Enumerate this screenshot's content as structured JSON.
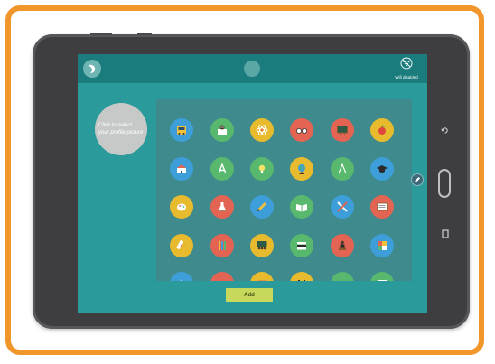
{
  "topbar": {
    "wifi_label": "Wifi disabled"
  },
  "profile": {
    "prompt": "Click to select your profile picture"
  },
  "actions": {
    "add_label": "Add"
  },
  "icon_grid": {
    "rows": [
      [
        {
          "name": "school-bus-icon",
          "color": "#3d9ed9"
        },
        {
          "name": "book-owl-icon",
          "color": "#58b86d"
        },
        {
          "name": "atom-icon",
          "color": "#e8bb2f"
        },
        {
          "name": "glasses-icon",
          "color": "#e46454"
        },
        {
          "name": "blackboard-icon",
          "color": "#e46454"
        },
        {
          "name": "apple-icon",
          "color": "#e8bb2f"
        }
      ],
      [
        {
          "name": "school-building-icon",
          "color": "#3d9ed9"
        },
        {
          "name": "letter-a-icon",
          "color": "#58b86d"
        },
        {
          "name": "lightbulb-icon",
          "color": "#58b86d"
        },
        {
          "name": "globe-icon",
          "color": "#e8bb2f"
        },
        {
          "name": "compass-icon",
          "color": "#58b86d"
        },
        {
          "name": "graduation-cap-icon",
          "color": "#3d9ed9"
        }
      ],
      [
        {
          "name": "palette-icon",
          "color": "#e8bb2f"
        },
        {
          "name": "flask-icon",
          "color": "#e46454"
        },
        {
          "name": "pencil-icon",
          "color": "#3d9ed9"
        },
        {
          "name": "open-book-icon",
          "color": "#58b86d"
        },
        {
          "name": "ruler-pencil-icon",
          "color": "#3d9ed9"
        },
        {
          "name": "certificate-icon",
          "color": "#e46454"
        }
      ],
      [
        {
          "name": "diploma-icon",
          "color": "#e8bb2f"
        },
        {
          "name": "pencils-icon",
          "color": "#e46454"
        },
        {
          "name": "classroom-icon",
          "color": "#e8bb2f"
        },
        {
          "name": "books-stack-icon",
          "color": "#58b86d"
        },
        {
          "name": "teacher-icon",
          "color": "#e46454"
        },
        {
          "name": "puzzle-icon",
          "color": "#3d9ed9"
        }
      ],
      [
        {
          "name": "rocket-icon",
          "color": "#3d9ed9"
        },
        {
          "name": "basketball-icon",
          "color": "#e46454"
        },
        {
          "name": "calendar-icon",
          "color": "#e8bb2f"
        },
        {
          "name": "castle-icon",
          "color": "#e8bb2f"
        },
        {
          "name": "bell-icon",
          "color": "#58b86d"
        },
        {
          "name": "monitor-icon",
          "color": "#58b86d"
        }
      ]
    ]
  }
}
